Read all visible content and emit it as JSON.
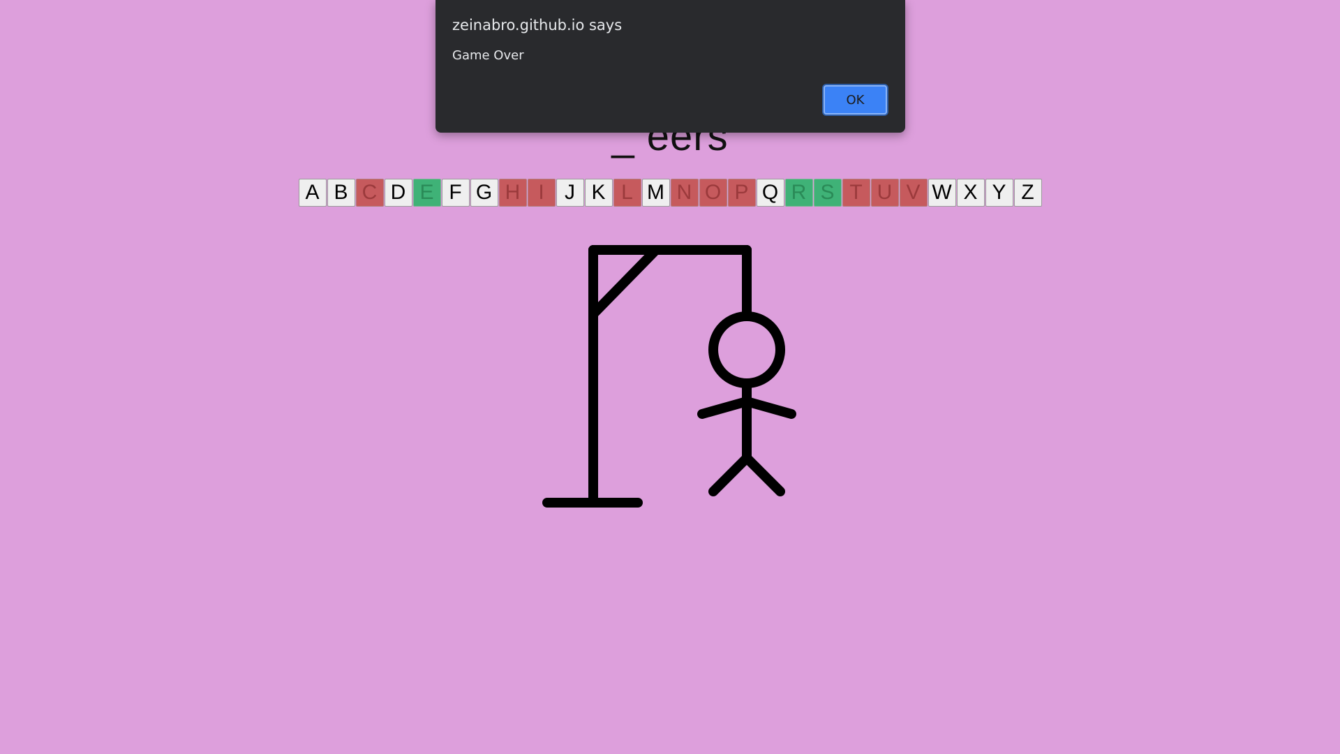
{
  "game": {
    "word_display": "_ eers"
  },
  "keyboard": {
    "keys": [
      {
        "letter": "A",
        "state": "unused"
      },
      {
        "letter": "B",
        "state": "unused"
      },
      {
        "letter": "C",
        "state": "wrong"
      },
      {
        "letter": "D",
        "state": "unused"
      },
      {
        "letter": "E",
        "state": "right"
      },
      {
        "letter": "F",
        "state": "unused"
      },
      {
        "letter": "G",
        "state": "unused"
      },
      {
        "letter": "H",
        "state": "wrong"
      },
      {
        "letter": "I",
        "state": "wrong"
      },
      {
        "letter": "J",
        "state": "unused"
      },
      {
        "letter": "K",
        "state": "unused"
      },
      {
        "letter": "L",
        "state": "wrong"
      },
      {
        "letter": "M",
        "state": "unused"
      },
      {
        "letter": "N",
        "state": "wrong"
      },
      {
        "letter": "O",
        "state": "wrong"
      },
      {
        "letter": "P",
        "state": "wrong"
      },
      {
        "letter": "Q",
        "state": "unused"
      },
      {
        "letter": "R",
        "state": "right"
      },
      {
        "letter": "S",
        "state": "right"
      },
      {
        "letter": "T",
        "state": "wrong"
      },
      {
        "letter": "U",
        "state": "wrong"
      },
      {
        "letter": "V",
        "state": "wrong"
      },
      {
        "letter": "W",
        "state": "unused"
      },
      {
        "letter": "X",
        "state": "unused"
      },
      {
        "letter": "Y",
        "state": "unused"
      },
      {
        "letter": "Z",
        "state": "unused"
      }
    ]
  },
  "dialog": {
    "title": "zeinabro.github.io says",
    "message": "Game Over",
    "ok_label": "OK"
  },
  "colors": {
    "background": "#dd9fdc",
    "wrong": "#c65a5d",
    "right": "#3fb277",
    "dialog_bg": "#292a2d",
    "ok_button": "#3b82f6"
  }
}
